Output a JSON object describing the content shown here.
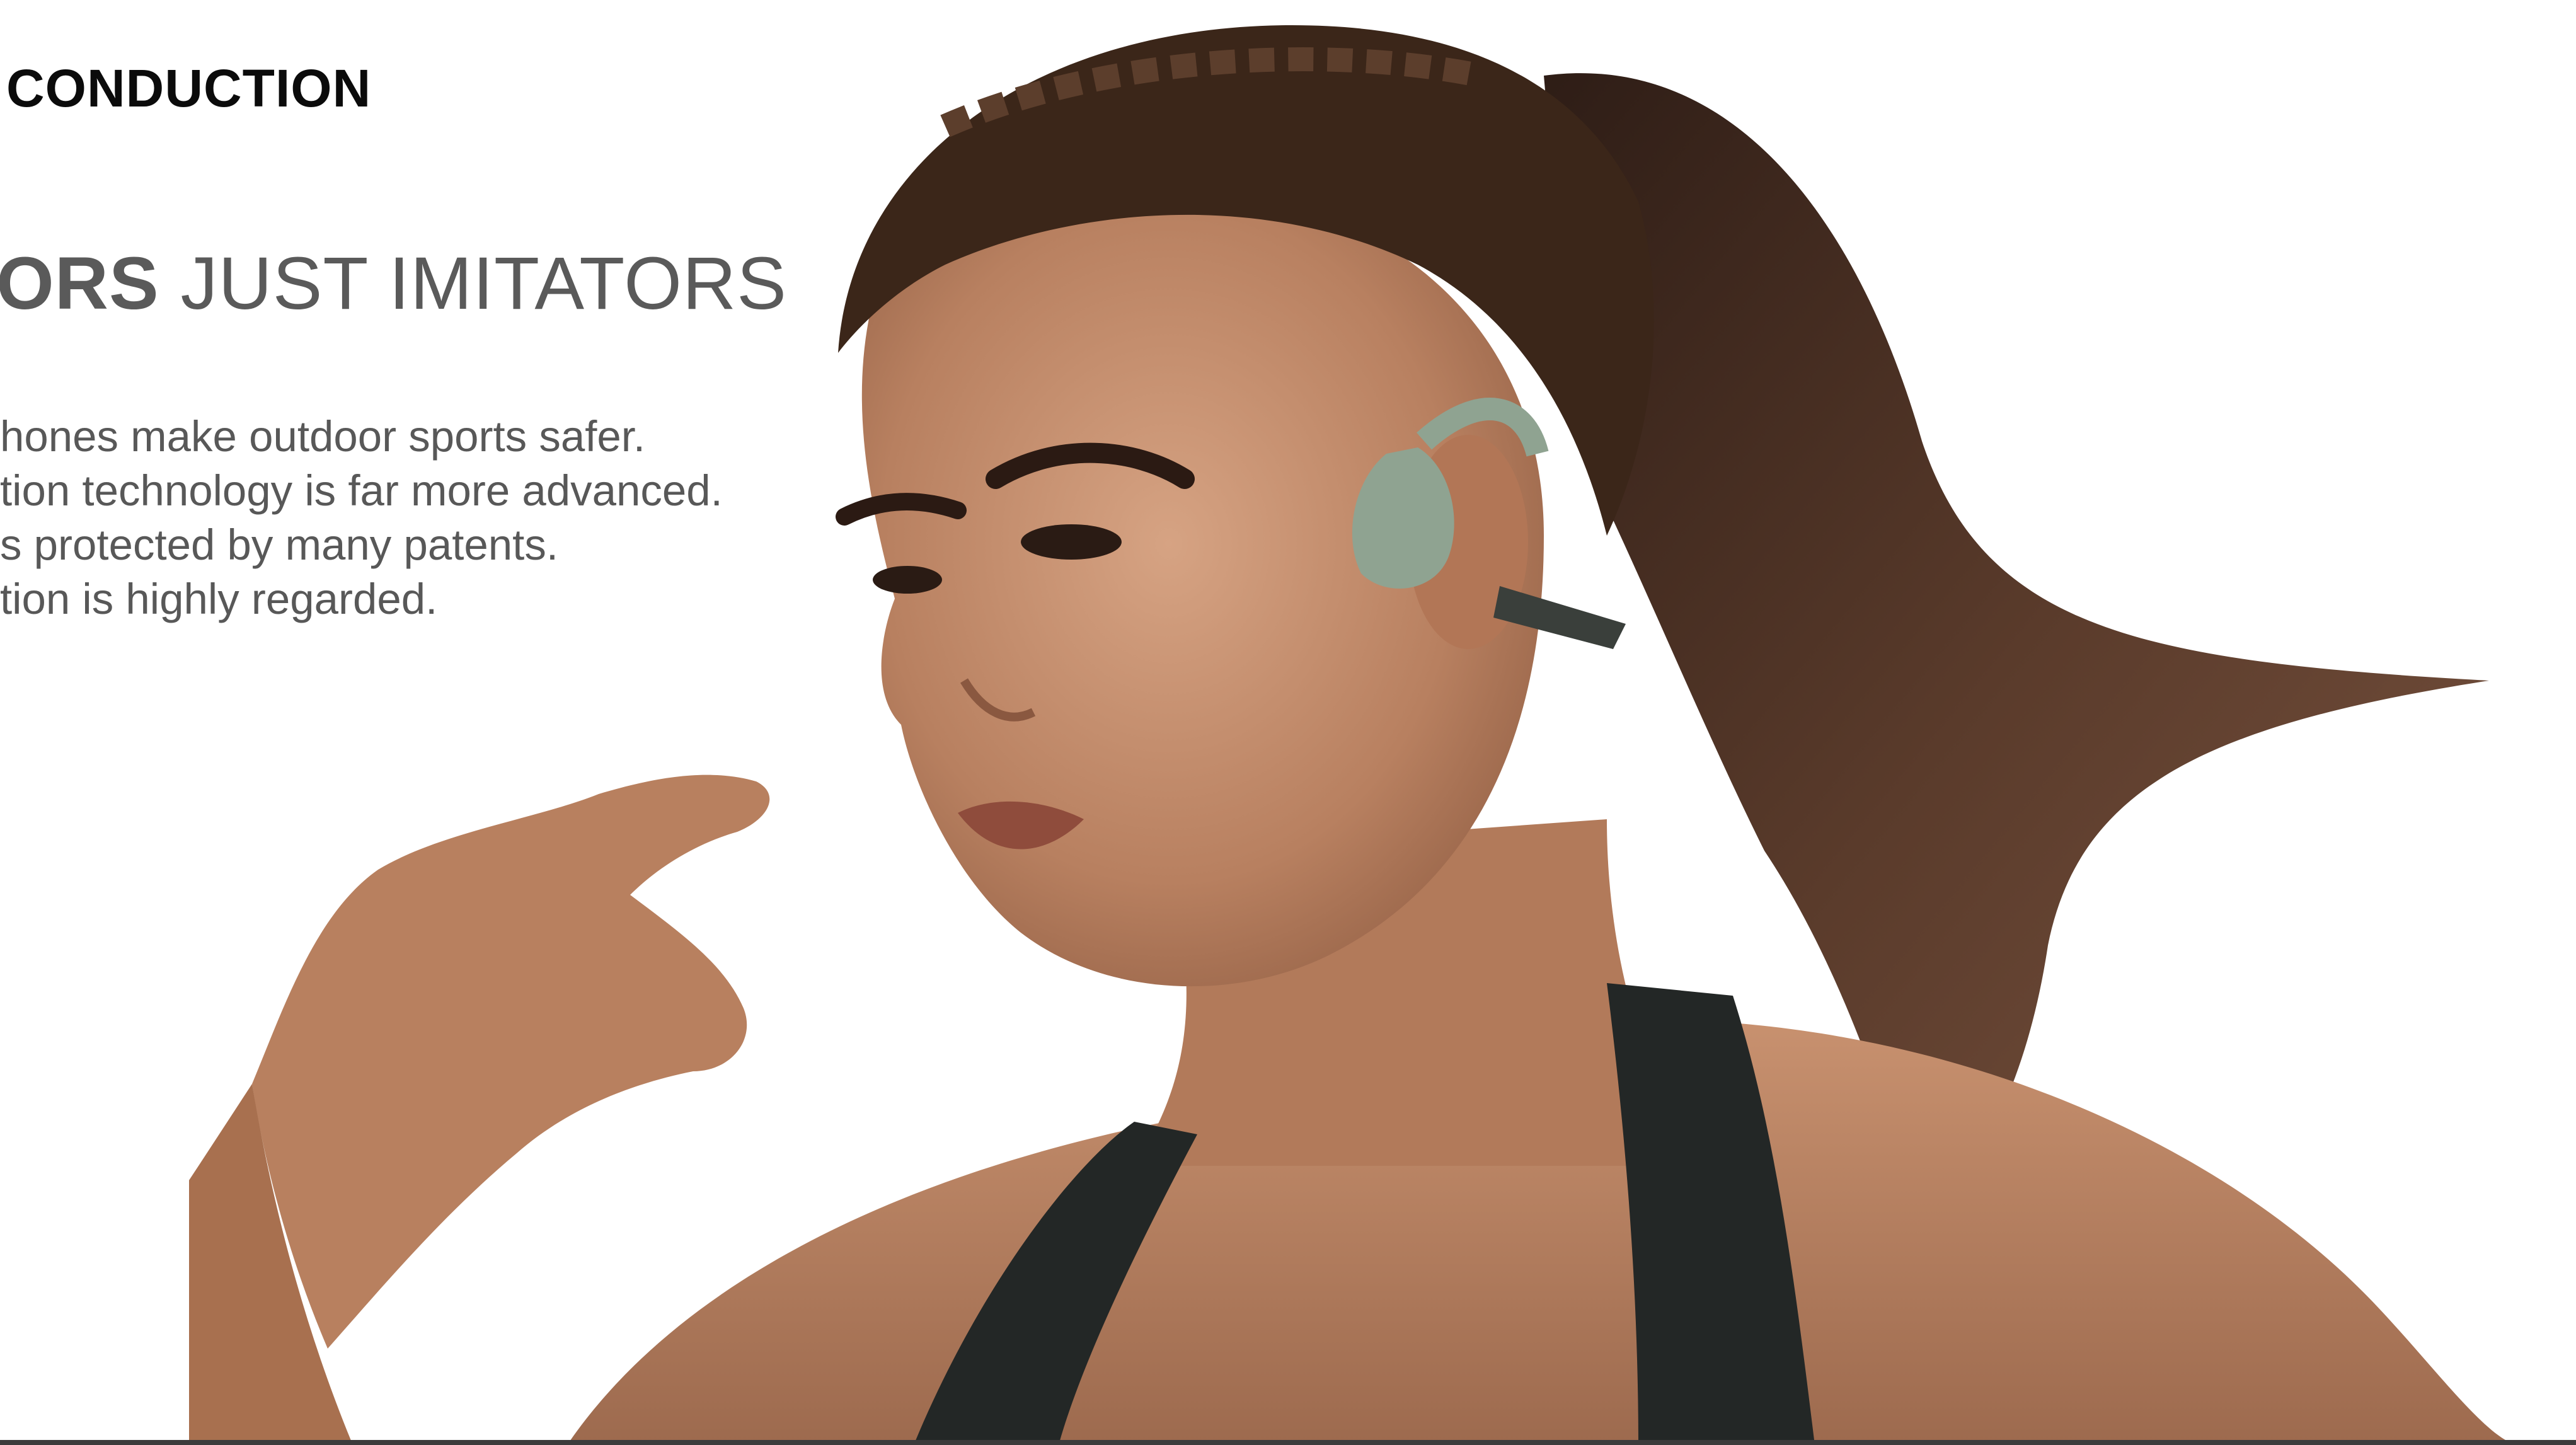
{
  "slide": {
    "small_heading": "CONDUCTION",
    "headline_bold": "ORS",
    "headline_rest": " JUST IMITATORS",
    "bullets": [
      "hones make outdoor sports safer.",
      "tion technology is far more advanced.",
      "s protected by many patents.",
      "tion is highly regarded."
    ]
  },
  "colors": {
    "background": "#ffffff",
    "heading_text": "#0b0b0b",
    "body_text": "#585858",
    "headset_green": "#8fa391",
    "headset_dark": "#3a3f3b",
    "tank_top": "#232726",
    "skin": "#c08a68",
    "hair": "#4a3125"
  },
  "images": {
    "hero_photo": "woman-running-with-bone-conduction-headphones"
  }
}
